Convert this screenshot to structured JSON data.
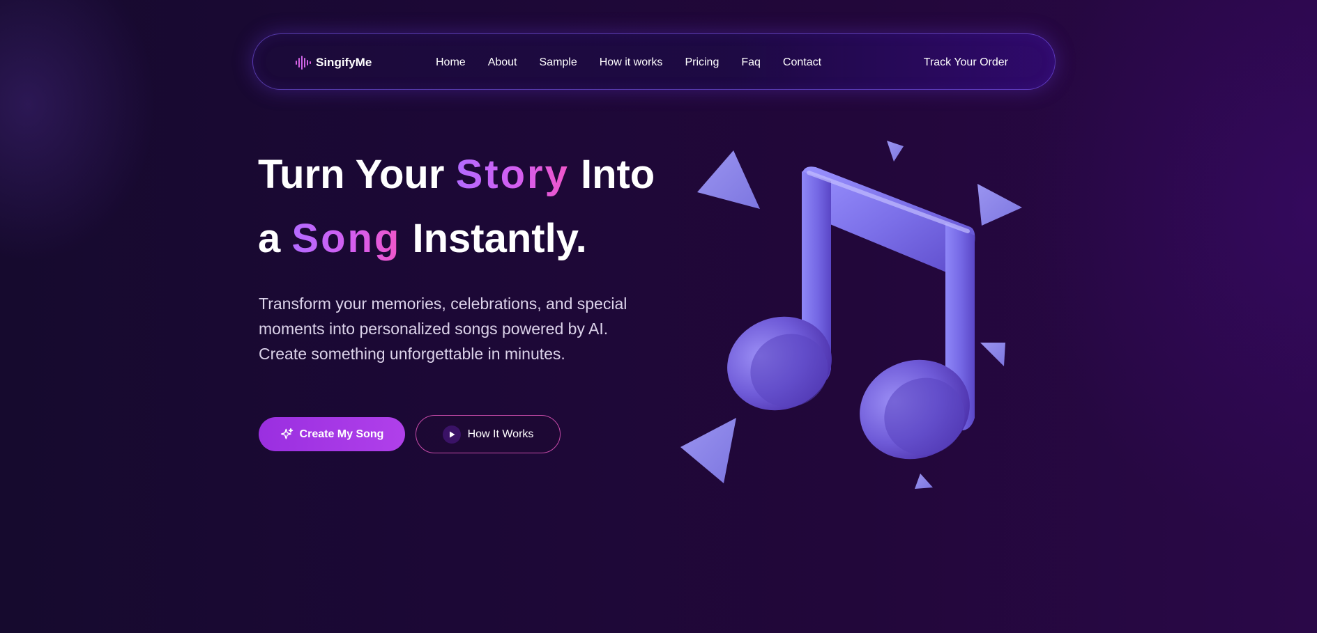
{
  "brand": {
    "name": "SingifyMe",
    "icon": "sound-wave-icon"
  },
  "nav": {
    "links": [
      "Home",
      "About",
      "Sample",
      "How it works",
      "Pricing",
      "Faq",
      "Contact"
    ],
    "track_order": "Track Your Order"
  },
  "hero": {
    "title_line1_a": "Turn Your",
    "title_line1_highlight": "Story",
    "title_line1_b": "Into",
    "title_line2_a": "a",
    "title_line2_highlight": "Song",
    "title_line2_b": "Instantly.",
    "subtitle_line1": "Transform your memories, celebrations, and special",
    "subtitle_line2": "moments into personalized songs powered by AI.",
    "subtitle_line3": "Create something unforgettable in minutes."
  },
  "buttons": {
    "primary_label": "Create My Song",
    "primary_icon": "sparkle-icon",
    "secondary_label": "How It Works",
    "secondary_icon": "play-icon"
  },
  "illustration": {
    "subject": "music-note-icon",
    "decoration": "triangle-shapes"
  },
  "colors": {
    "background": "#1c0836",
    "accent_purple": "#a13be6",
    "highlight_gradient_start": "#b36bff",
    "highlight_gradient_end": "#f056c8",
    "note_color": "#7c74e6",
    "nav_border": "#8460ff"
  }
}
